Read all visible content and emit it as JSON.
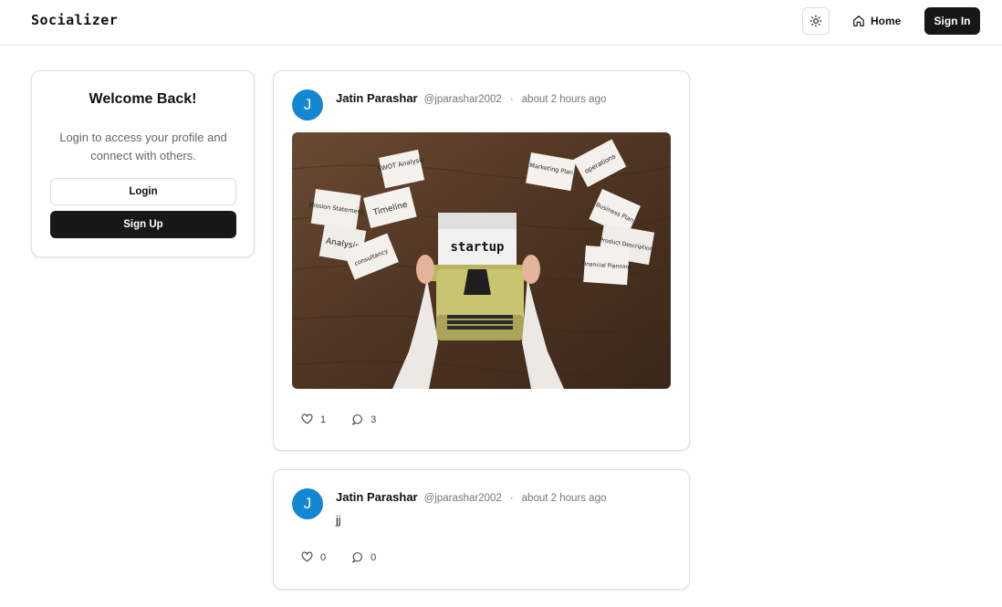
{
  "header": {
    "brand": "Socializer",
    "theme_icon": "sun-icon",
    "home_label": "Home",
    "signin_label": "Sign In"
  },
  "welcome": {
    "title": "Welcome Back!",
    "text": "Login to access your profile and connect with others.",
    "login_label": "Login",
    "signup_label": "Sign Up"
  },
  "posts": [
    {
      "avatar_letter": "J",
      "author": "Jatin Parashar",
      "handle": "@jparashar2002",
      "separator": "·",
      "time": "about 2 hours ago",
      "image": {
        "main_word": "startup",
        "notes": [
          "SWOT Analysis",
          "Mission Statement",
          "Timeline",
          "Analysis",
          "consultancy",
          "Marketing Plan",
          "operations",
          "Business Plan",
          "Product Description",
          "Financial Planning"
        ]
      },
      "likes": "1",
      "comments": "3"
    },
    {
      "avatar_letter": "J",
      "author": "Jatin Parashar",
      "handle": "@jparashar2002",
      "separator": "·",
      "time": "about 2 hours ago",
      "text": "jj",
      "likes": "0",
      "comments": "0"
    }
  ],
  "colors": {
    "accent_dark": "#171717",
    "avatar_blue": "#1487d3",
    "border": "#dedede"
  }
}
